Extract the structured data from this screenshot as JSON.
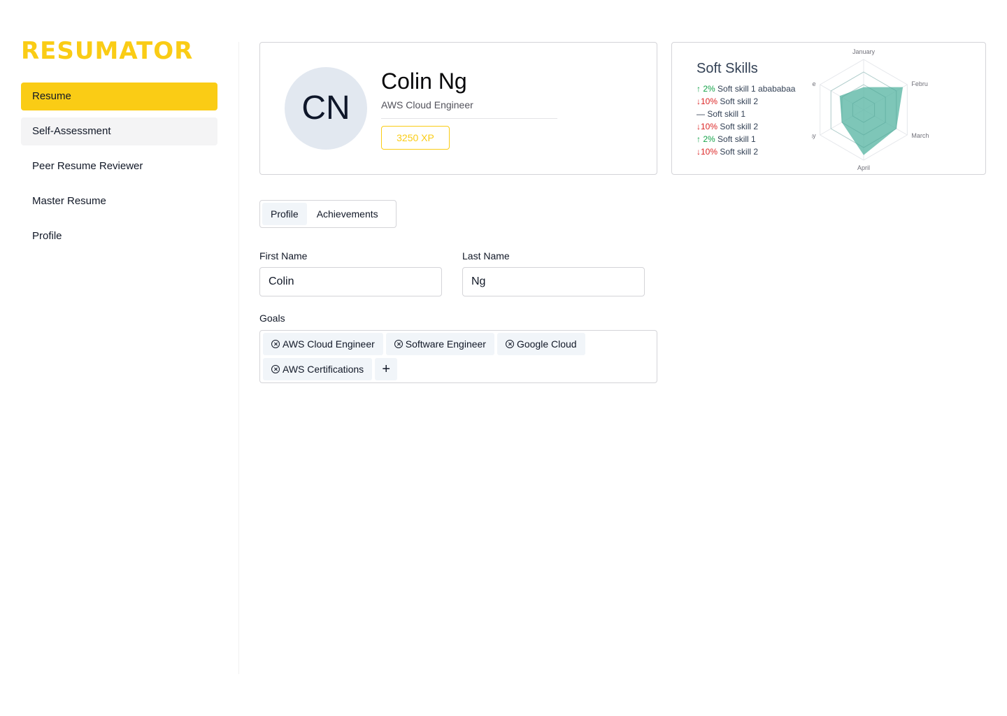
{
  "app": {
    "logo": "RESUMATOR",
    "brand_color": "#facc15"
  },
  "sidebar": {
    "items": [
      {
        "label": "Resume",
        "state": "active"
      },
      {
        "label": "Self-Assessment",
        "state": "hover"
      },
      {
        "label": "Peer Resume Reviewer",
        "state": "default"
      },
      {
        "label": "Master Resume",
        "state": "default"
      },
      {
        "label": "Profile",
        "state": "default"
      }
    ]
  },
  "profile": {
    "initials": "CN",
    "name": "Colin Ng",
    "role": "AWS Cloud Engineer",
    "xp": "3250 XP"
  },
  "soft_skills": {
    "title": "Soft Skills",
    "items": [
      {
        "trend": "up",
        "arrow": "↑",
        "change": " 2%",
        "label": "Soft skill 1 abababaa"
      },
      {
        "trend": "down",
        "arrow": "↓",
        "change": "10%",
        "label": "Soft skill 2"
      },
      {
        "trend": "flat",
        "arrow": "—",
        "change": "",
        "label": "Soft skill 1"
      },
      {
        "trend": "down",
        "arrow": "↓",
        "change": "10%",
        "label": "Soft skill 2"
      },
      {
        "trend": "up",
        "arrow": "↑",
        "change": " 2%",
        "label": "Soft skill 1"
      },
      {
        "trend": "down",
        "arrow": "↓",
        "change": "10%",
        "label": "Soft skill 2"
      }
    ],
    "colors": {
      "up": "#16a34a",
      "down": "#dc2626",
      "radar_fill": "#5eb8a6"
    }
  },
  "chart_data": {
    "type": "radar",
    "categories": [
      "January",
      "Febru",
      "March",
      "April",
      "May",
      "June"
    ],
    "values": [
      0.45,
      0.9,
      0.75,
      0.9,
      0.5,
      0.55
    ],
    "range": [
      0,
      1
    ],
    "grid": true
  },
  "tabs": [
    {
      "label": "Profile",
      "active": true
    },
    {
      "label": "Achievements",
      "active": false
    }
  ],
  "form": {
    "first_name_label": "First Name",
    "first_name_value": "Colin",
    "last_name_label": "Last Name",
    "last_name_value": "Ng",
    "goals_label": "Goals",
    "goals": [
      "AWS Cloud Engineer",
      "Software Engineer",
      "Google Cloud",
      "AWS Certifications"
    ],
    "add_goal_label": "+"
  }
}
